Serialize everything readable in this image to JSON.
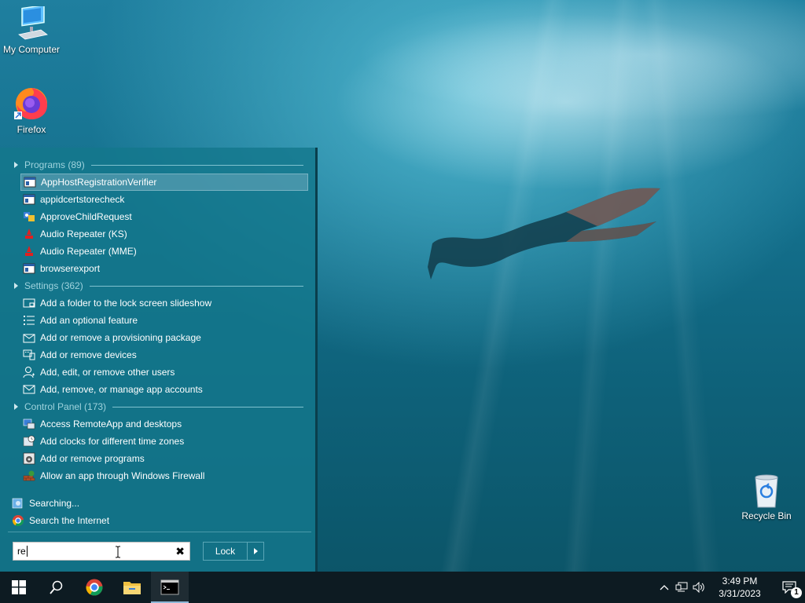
{
  "desktop": {
    "icons": [
      {
        "label": "My Computer"
      },
      {
        "label": "Firefox"
      },
      {
        "label": "Recycle Bin"
      }
    ]
  },
  "start_menu": {
    "sections": [
      {
        "header": "Programs (89)",
        "items": [
          {
            "label": "AppHostRegistrationVerifier",
            "icon": "app-window-icon",
            "selected": true
          },
          {
            "label": "appidcertstorecheck",
            "icon": "app-window-icon"
          },
          {
            "label": "ApproveChildRequest",
            "icon": "shield-users-icon"
          },
          {
            "label": "Audio Repeater (KS)",
            "icon": "audio-repeater-icon"
          },
          {
            "label": "Audio Repeater (MME)",
            "icon": "audio-repeater-icon"
          },
          {
            "label": "browserexport",
            "icon": "app-window-icon"
          }
        ]
      },
      {
        "header": "Settings (362)",
        "items": [
          {
            "label": "Add a folder to the lock screen slideshow",
            "icon": "slideshow-icon"
          },
          {
            "label": "Add an optional feature",
            "icon": "list-icon"
          },
          {
            "label": "Add or remove a provisioning package",
            "icon": "package-icon"
          },
          {
            "label": "Add or remove devices",
            "icon": "devices-icon"
          },
          {
            "label": "Add, edit, or remove other users",
            "icon": "user-icon"
          },
          {
            "label": "Add, remove, or manage app accounts",
            "icon": "mail-icon"
          }
        ]
      },
      {
        "header": "Control Panel (173)",
        "items": [
          {
            "label": "Access RemoteApp and desktops",
            "icon": "remote-desktop-icon"
          },
          {
            "label": "Add clocks for different time zones",
            "icon": "clock-icon"
          },
          {
            "label": "Add or remove programs",
            "icon": "programs-icon"
          },
          {
            "label": "Allow an app through Windows Firewall",
            "icon": "firewall-icon"
          }
        ]
      }
    ],
    "searching_label": "Searching...",
    "search_internet_label": "Search the Internet",
    "search_value": "re",
    "lock_label": "Lock"
  },
  "taskbar": {
    "clock_time": "3:49 PM",
    "clock_date": "3/31/2023",
    "notification_count": "1"
  }
}
